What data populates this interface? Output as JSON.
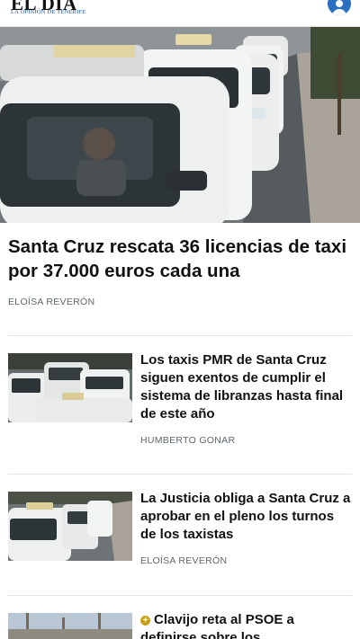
{
  "header": {
    "logo": "EL DÍA",
    "tagline": "LA OPINIÓN DE TENERIFE",
    "user_icon": "user-account-icon"
  },
  "lead": {
    "title": "Santa Cruz rescata 36 licencias de taxi por 37.000 euros cada una",
    "author": "ELOÍSA REVERÓN"
  },
  "articles": [
    {
      "title": "Los taxis PMR de Santa Cruz siguen exentos de cumplir el sistema de libranzas hasta final de este año",
      "author": "HUMBERTO GONAR"
    },
    {
      "title": "La Justicia obliga a Santa Cruz a aprobar en el pleno los turnos de los taxistas",
      "author": "ELOÍSA REVERÓN"
    },
    {
      "premium_icon": "+",
      "title": "Clavijo reta al PSOE a definirse sobre los",
      "author": ""
    }
  ],
  "colors": {
    "brand_blue": "#2a6fc0",
    "byline_gray": "#5c6770",
    "premium_gold": "#c8a11c"
  }
}
